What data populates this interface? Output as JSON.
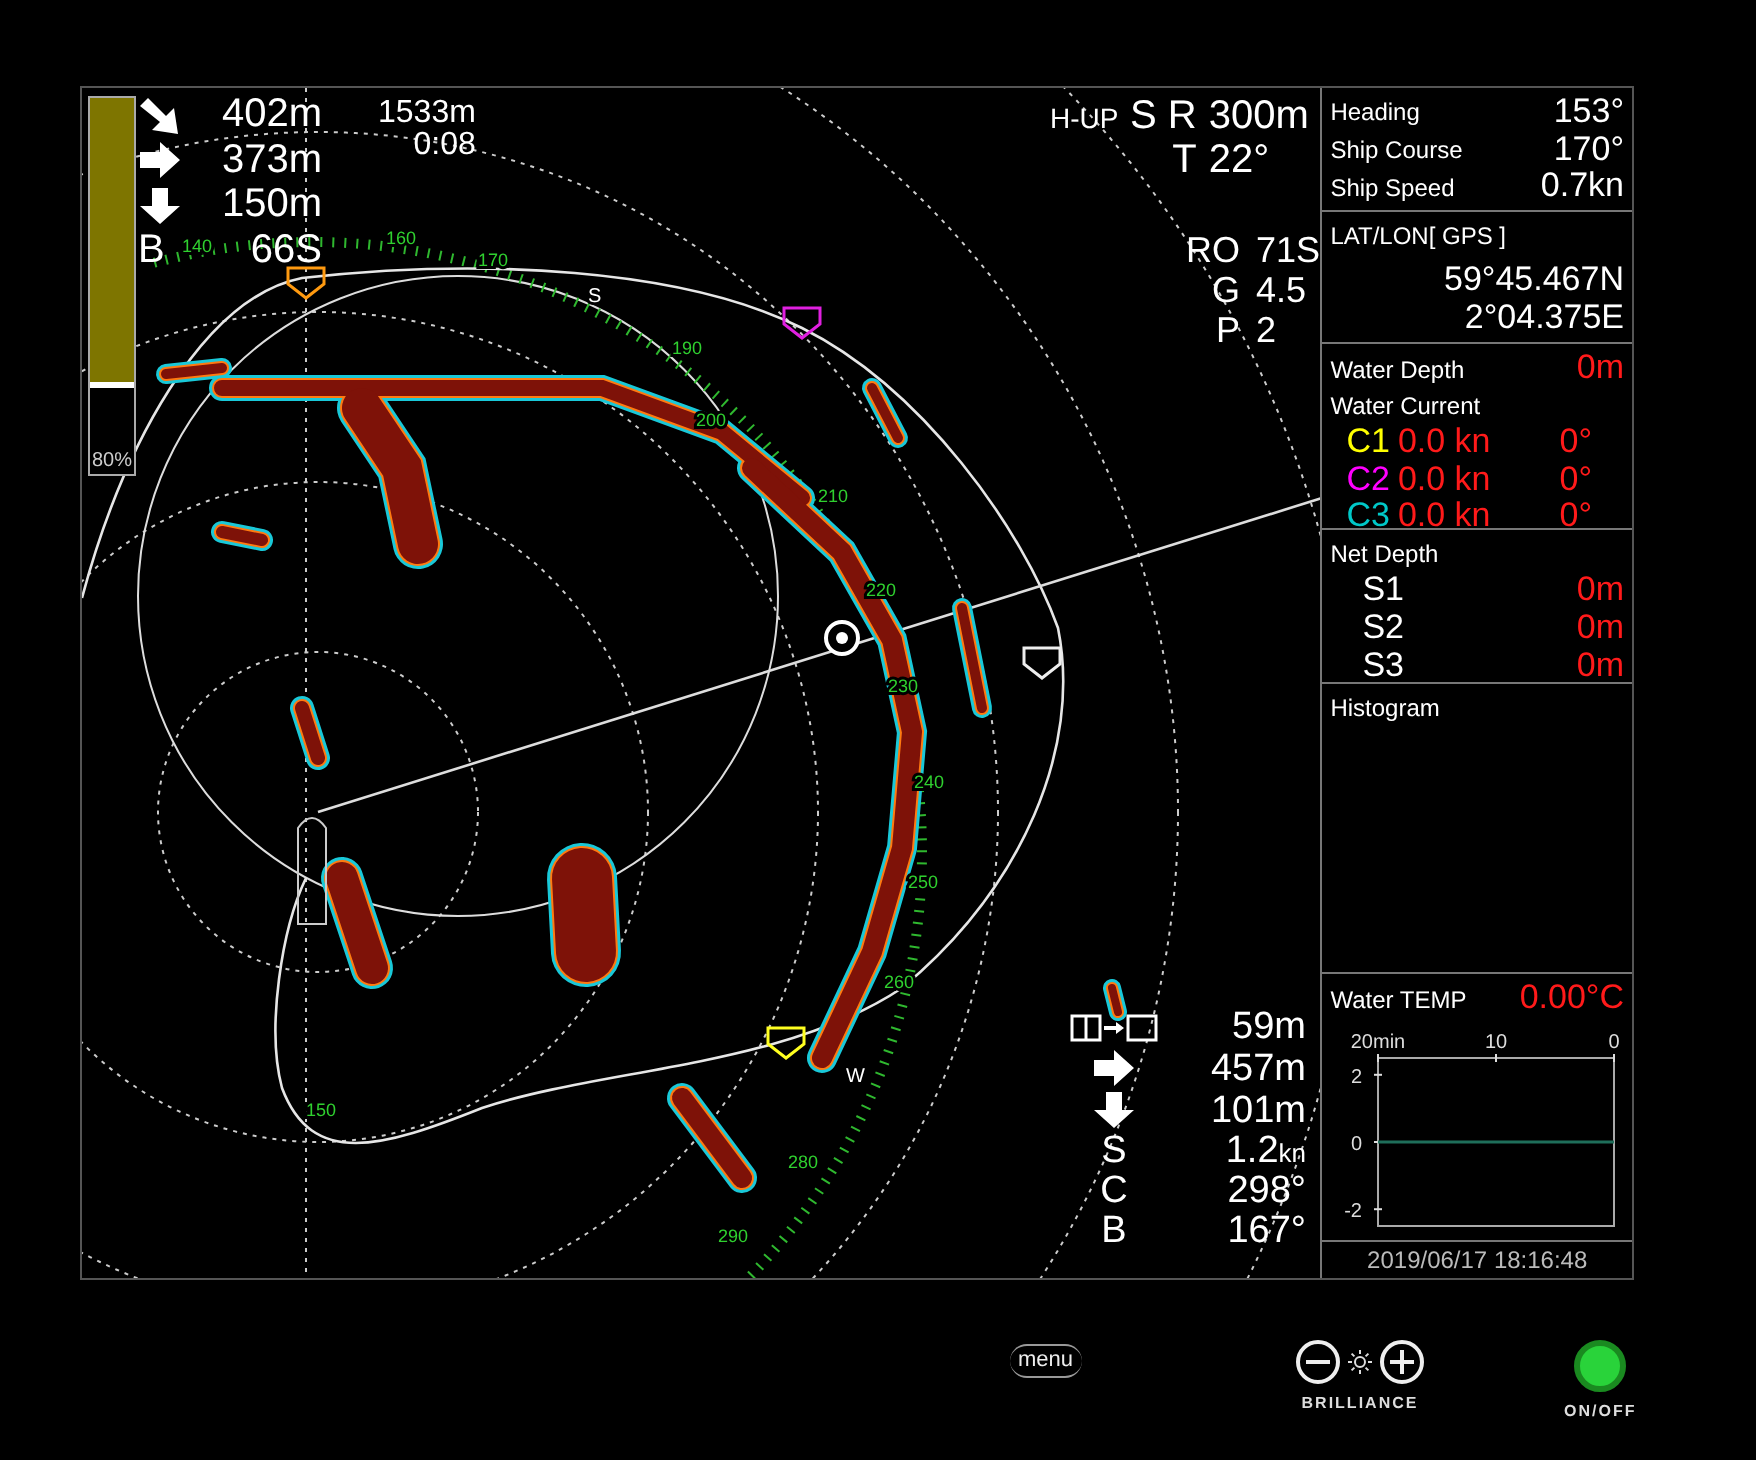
{
  "sonar": {
    "gain": {
      "level": 0.77,
      "label": "80%"
    },
    "readouts": [
      {
        "kind": "down-right-arrow",
        "value": "402m"
      },
      {
        "kind": "right-arrow",
        "value": "373m"
      },
      {
        "kind": "down-arrow",
        "value": "150m"
      },
      {
        "kind": "letter",
        "label": "B",
        "value": "66S"
      }
    ],
    "sound_speed": "1533m",
    "elapsed": "0:08",
    "orientation": "H-UP",
    "settings": [
      {
        "label": "S R",
        "value": "300m"
      },
      {
        "label": "T",
        "value": "22°"
      }
    ],
    "controls": [
      {
        "label": "RO",
        "value": "71S"
      },
      {
        "label": "G",
        "value": "4.5"
      },
      {
        "label": "P",
        "value": "2"
      }
    ],
    "bearing_labels": [
      "140",
      "160",
      "170",
      "S",
      "190",
      "200",
      "210",
      "220",
      "230",
      "240",
      "250",
      "260",
      "W",
      "280",
      "290",
      "150"
    ],
    "target": [
      {
        "kind": "track-change",
        "value": "59m"
      },
      {
        "kind": "right-arrow",
        "value": "457m"
      },
      {
        "kind": "down-arrow",
        "value": "101m"
      },
      {
        "kind": "letter",
        "label": "S",
        "value": "1.2",
        "unit": "kn"
      },
      {
        "kind": "letter",
        "label": "C",
        "value": "298°"
      },
      {
        "kind": "letter",
        "label": "B",
        "value": "167°"
      }
    ]
  },
  "panel": {
    "navigation": [
      {
        "label": "Heading",
        "value": "153°"
      },
      {
        "label": "Ship Course",
        "value": "170°"
      },
      {
        "label": "Ship Speed",
        "value": "0.7kn"
      }
    ],
    "position": {
      "label": "LAT/LON[ GPS ]",
      "lat": "59°45.467N",
      "lon": "2°04.375E"
    },
    "water": {
      "depth_label": "Water Depth",
      "depth": "0m",
      "current_label": "Water Current",
      "currents": [
        {
          "name": "C1",
          "color": "#ffff00",
          "speed": "0.0 kn",
          "direction": "0°"
        },
        {
          "name": "C2",
          "color": "#ff00ff",
          "speed": "0.0 kn",
          "direction": "0°"
        },
        {
          "name": "C3",
          "color": "#00c8c8",
          "speed": "0.0 kn",
          "direction": "0°"
        }
      ]
    },
    "net_depth": {
      "label": "Net Depth",
      "sensors": [
        {
          "name": "S1",
          "value": "0m"
        },
        {
          "name": "S2",
          "value": "0m"
        },
        {
          "name": "S3",
          "value": "0m"
        }
      ]
    },
    "histogram": {
      "label": "Histogram"
    },
    "water_temp": {
      "label": "Water TEMP",
      "value": "0.00°C",
      "chart_data": {
        "type": "line",
        "categories": [
          "20min",
          "10",
          "0"
        ],
        "ylim": [
          -2.5,
          2.5
        ],
        "yticks": [
          2,
          0,
          -2
        ],
        "series": [
          {
            "color": "#1f6e5a",
            "values": [
              0,
              0,
              0
            ]
          }
        ]
      }
    },
    "timestamp": "2019/06/17 18:16:48"
  },
  "bezel": {
    "menu_label": "menu",
    "brilliance_label": "BRILLIANCE",
    "power_label": "ON/OFF",
    "power_on": true
  }
}
